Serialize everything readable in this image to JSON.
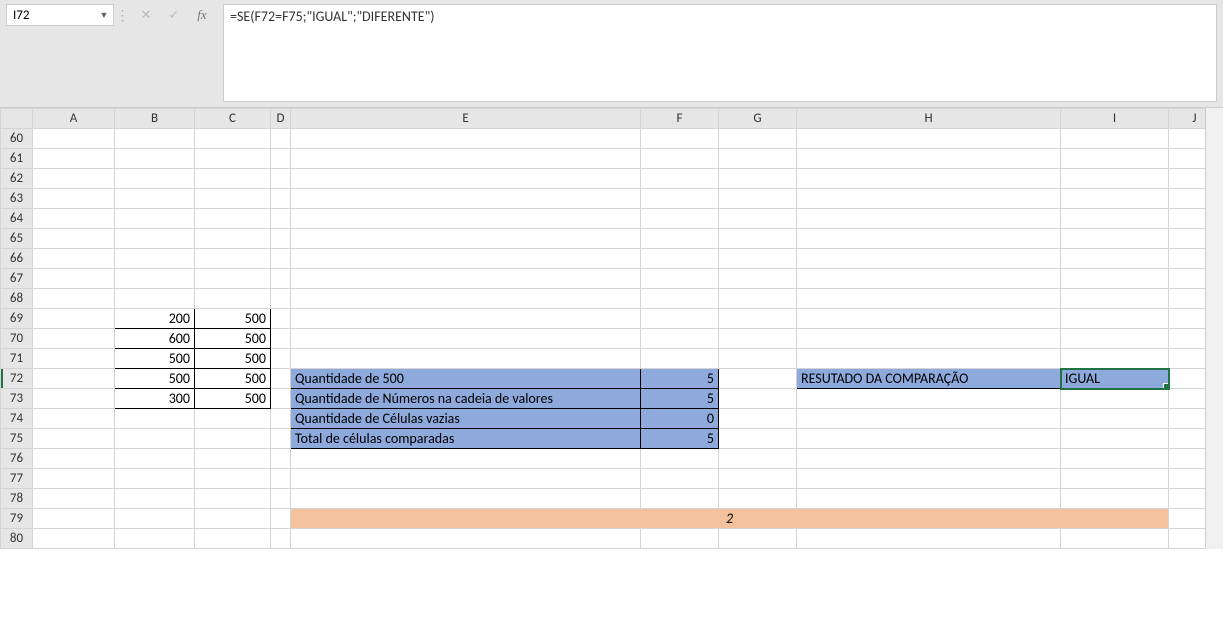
{
  "nameBox": "I72",
  "formula": "=SE(F72=F75;\"IGUAL\";\"DIFERENTE\")",
  "columns": [
    "A",
    "B",
    "C",
    "D",
    "E",
    "F",
    "G",
    "H",
    "I",
    "J"
  ],
  "rowStart": 60,
  "rowEnd": 80,
  "cells": {
    "B69": "200",
    "C69": "500",
    "B70": "600",
    "C70": "500",
    "B71": "500",
    "C71": "500",
    "B72": "500",
    "C72": "500",
    "B73": "300",
    "C73": "500",
    "E72": "Quantidade de 500",
    "F72": "5",
    "E73": "Quantidade de Números na cadeia de valores",
    "F73": "5",
    "E74": "Quantidade de Células vazias",
    "F74": "0",
    "E75": "Total de células comparadas",
    "F75": "5",
    "H72": "RESUTADO DA COMPARAÇÃO",
    "I72": "IGUAL",
    "row79": "2"
  },
  "icons": {
    "dropdown": "▼",
    "cancel": "✕",
    "confirm": "✓"
  },
  "chart_data": null
}
